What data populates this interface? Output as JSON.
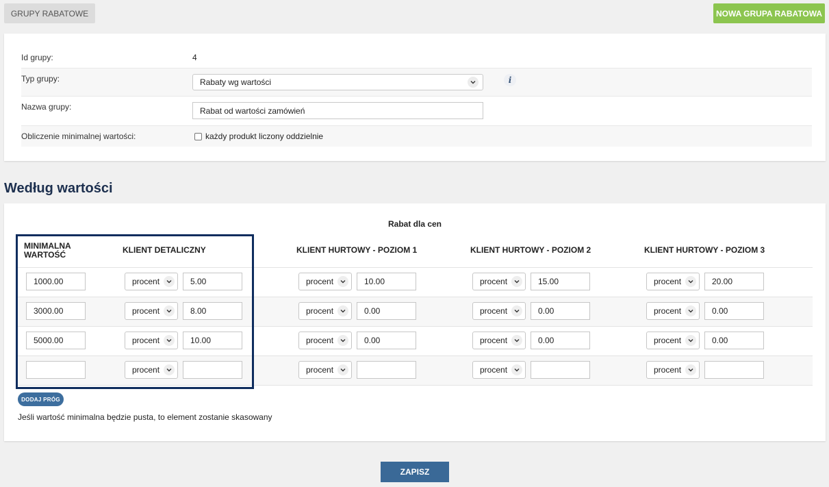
{
  "toolbar": {
    "left_button": "GRUPY RABATOWE",
    "right_button": "NOWA GRUPA RABATOWA"
  },
  "group_form": {
    "id_label": "Id grupy:",
    "id_value": "4",
    "type_label": "Typ grupy:",
    "type_value": "Rabaty wg wartości",
    "name_label": "Nazwa grupy:",
    "name_value": "Rabat od wartości zamówień",
    "min_calc_label": "Obliczenie minimalnej wartości:",
    "min_calc_checkbox_label": "każdy produkt liczony oddzielnie",
    "min_calc_checked": false
  },
  "section_title": "Według wartości",
  "discount_table": {
    "caption": "Rabat dla cen",
    "headers": {
      "min_value_line1": "MINIMALNA",
      "min_value_line2": "WARTOŚĆ",
      "retail": "KLIENT DETALICZNY",
      "wholesale1": "KLIENT HURTOWY - POZIOM 1",
      "wholesale2": "KLIENT HURTOWY - POZIOM 2",
      "wholesale3": "KLIENT HURTOWY - POZIOM 3"
    },
    "rows": [
      {
        "min": "1000.00",
        "retail_type": "procent",
        "retail": "5.00",
        "w1_type": "procent",
        "w1": "10.00",
        "w2_type": "procent",
        "w2": "15.00",
        "w3_type": "procent",
        "w3": "20.00"
      },
      {
        "min": "3000.00",
        "retail_type": "procent",
        "retail": "8.00",
        "w1_type": "procent",
        "w1": "0.00",
        "w2_type": "procent",
        "w2": "0.00",
        "w3_type": "procent",
        "w3": "0.00"
      },
      {
        "min": "5000.00",
        "retail_type": "procent",
        "retail": "10.00",
        "w1_type": "procent",
        "w1": "0.00",
        "w2_type": "procent",
        "w2": "0.00",
        "w3_type": "procent",
        "w3": "0.00"
      },
      {
        "min": "",
        "retail_type": "procent",
        "retail": "",
        "w1_type": "procent",
        "w1": "",
        "w2_type": "procent",
        "w2": "",
        "w3_type": "procent",
        "w3": ""
      }
    ],
    "add_button": "DODAJ PRÓG",
    "note": "Jeśli wartość minimalna będzie pusta, to element zostanie skasowany"
  },
  "save_button": "ZAPISZ",
  "colors": {
    "accent_green": "#8cc54f",
    "primary_blue": "#3a6997",
    "highlight_navy": "#0f2d5e",
    "title_navy": "#1c2f4e"
  }
}
